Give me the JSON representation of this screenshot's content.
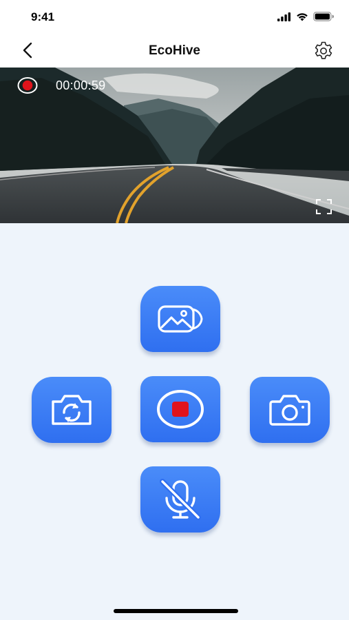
{
  "status_bar": {
    "time": "9:41",
    "icons": [
      "cellular-signal-icon",
      "wifi-icon",
      "battery-icon"
    ]
  },
  "header": {
    "title": "EcoHive",
    "back_icon": "chevron-left-icon",
    "settings_icon": "gear-icon"
  },
  "video": {
    "recording_indicator": "record-dot-icon",
    "recording_time": "00:00:59",
    "fullscreen_icon": "fullscreen-icon"
  },
  "controls": {
    "gallery_icon": "gallery-icon",
    "switch_camera_icon": "camera-switch-icon",
    "record_icon": "stop-record-icon",
    "snapshot_icon": "camera-icon",
    "mic_icon": "microphone-off-icon"
  },
  "colors": {
    "accent": "#3a7ef5",
    "record_red": "#e0131b",
    "background": "#eef4fb"
  }
}
